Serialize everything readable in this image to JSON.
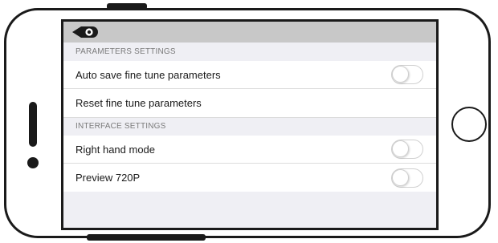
{
  "sections": [
    {
      "header": "PARAMETERS SETTINGS",
      "rows": [
        {
          "label": "Auto save fine tune parameters",
          "toggle": false
        },
        {
          "label": "Reset fine tune parameters"
        }
      ]
    },
    {
      "header": "INTERFACE SETTINGS",
      "rows": [
        {
          "label": "Right hand mode",
          "toggle": false
        },
        {
          "label": "Preview 720P",
          "toggle": false
        }
      ]
    }
  ],
  "colors": {
    "nav_bar": "#c8c8c8",
    "grouped_background": "#efeff4",
    "row_background": "#ffffff",
    "section_header_text": "#7a7a7a"
  },
  "icons": {
    "back": "back-arrow-icon"
  }
}
